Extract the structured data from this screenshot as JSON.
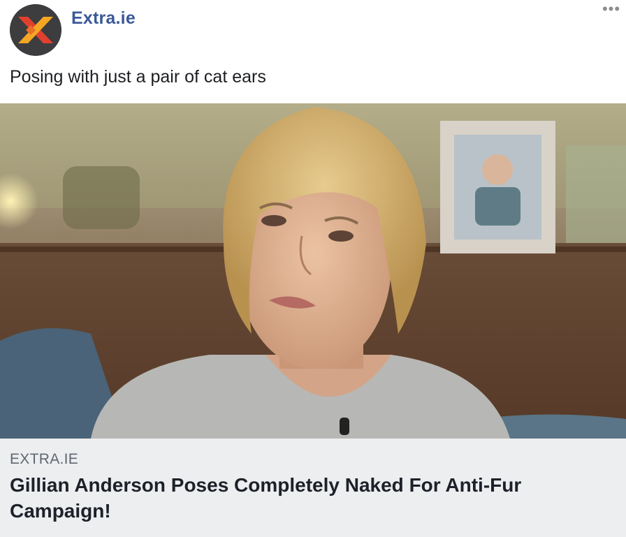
{
  "post": {
    "page_name": "Extra.ie",
    "more_icon": "•••",
    "text": "Posing with just a pair of cat ears"
  },
  "link_preview": {
    "domain": "EXTRA.IE",
    "headline": "Gillian Anderson Poses Completely Naked For Anti-Fur Campaign!"
  },
  "colors": {
    "brand_blue": "#3b5998",
    "logo_red": "#e2402e",
    "logo_orange": "#f5a623",
    "link_bg": "#edeef0"
  },
  "icons": {
    "avatar": "extra-ie-x-logo",
    "more": "horizontal-ellipsis-icon"
  }
}
